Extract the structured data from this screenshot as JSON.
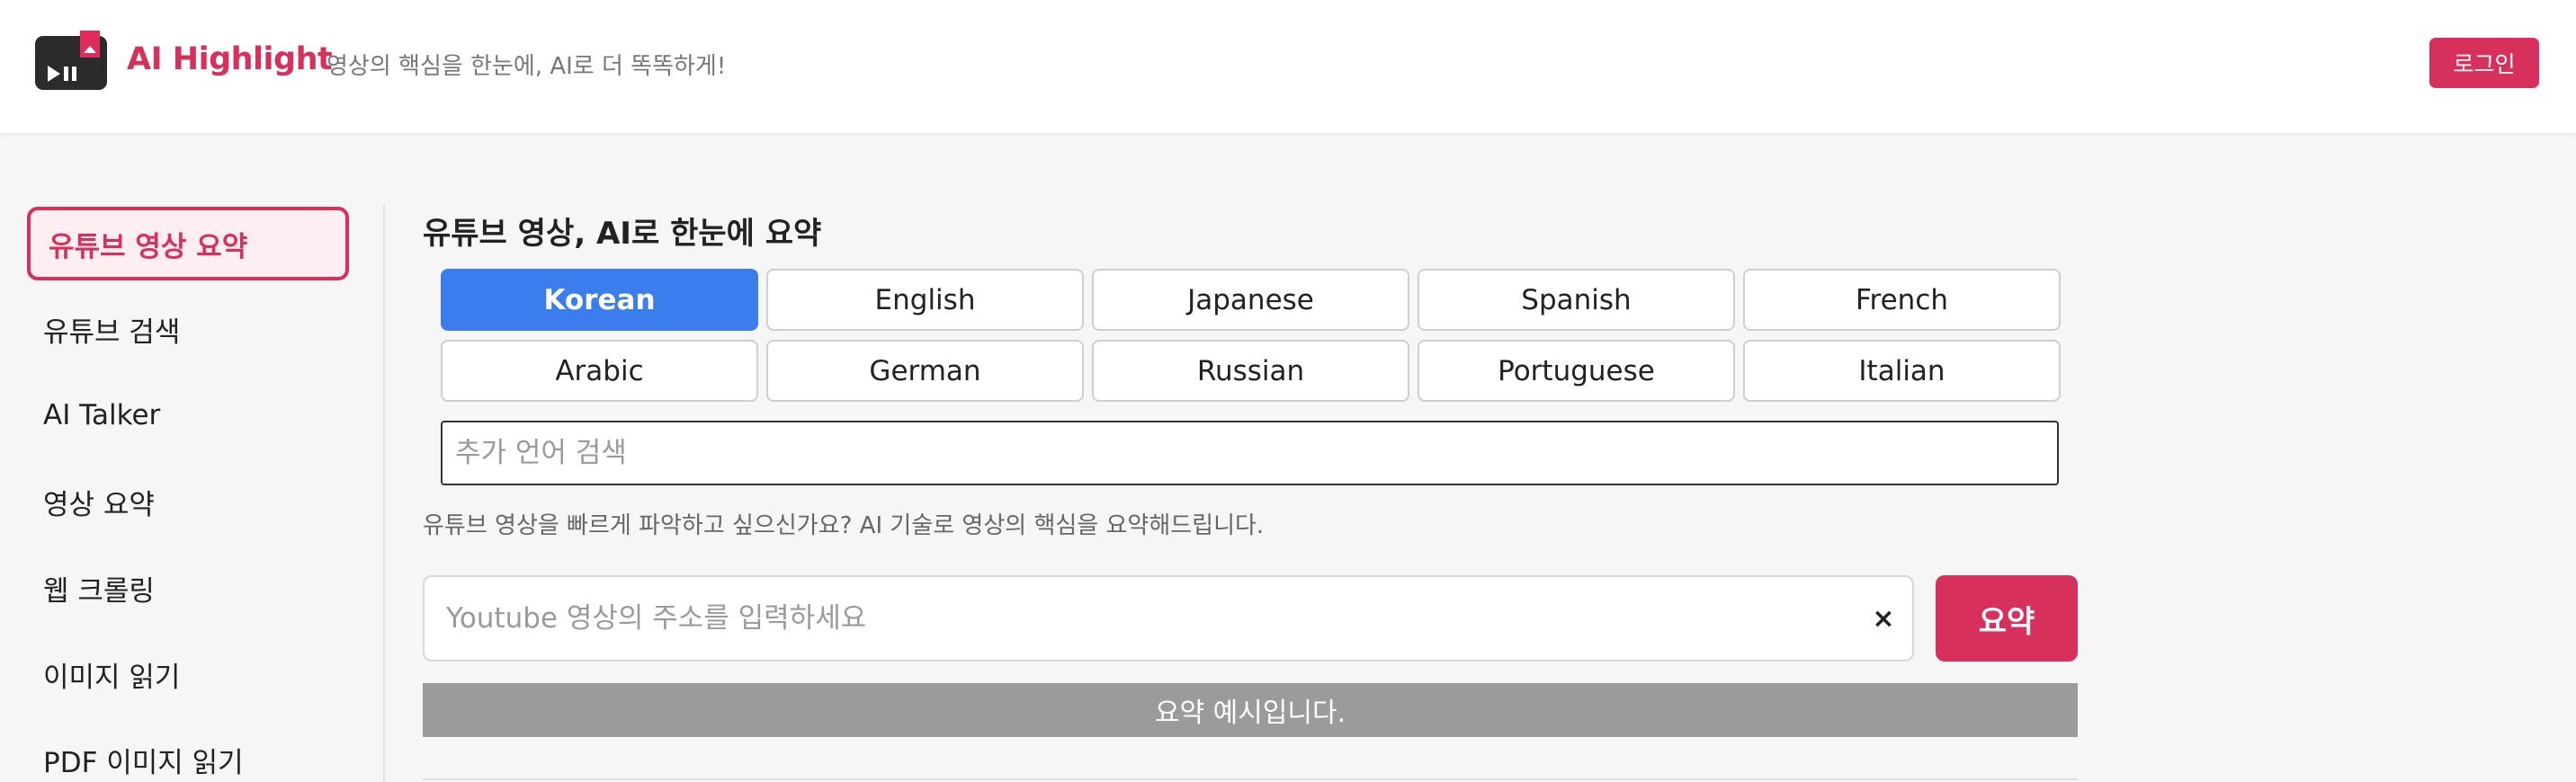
{
  "header": {
    "brand": "AI Highlight",
    "tagline": "영상의 핵심을 한눈에, AI로 더 똑똑하게!",
    "login_label": "로그인",
    "logo_icon": "play-pause-bookmark-icon",
    "accent_color": "#d8305c"
  },
  "sidebar": {
    "items": [
      {
        "label": "유튜브 영상 요약",
        "active": true
      },
      {
        "label": "유튜브 검색",
        "active": false
      },
      {
        "label": "AI Talker",
        "active": false
      },
      {
        "label": "영상 요약",
        "active": false
      },
      {
        "label": "웹 크롤링",
        "active": false
      },
      {
        "label": "이미지 읽기",
        "active": false
      },
      {
        "label": "PDF 이미지 읽기",
        "active": false
      }
    ]
  },
  "main": {
    "title": "유튜브 영상, AI로 한눈에 요약",
    "languages": [
      "Korean",
      "English",
      "Japanese",
      "Spanish",
      "French",
      "Arabic",
      "German",
      "Russian",
      "Portuguese",
      "Italian"
    ],
    "selected_language": "Korean",
    "selected_color": "#3b7ded",
    "language_search_placeholder": "추가 언어 검색",
    "language_search_value": "",
    "description": "유튜브 영상을 빠르게 파악하고 싶으신가요? AI 기술로 영상의 핵심을 요약해드립니다.",
    "url_placeholder": "Youtube 영상의 주소를 입력하세요",
    "url_value": "",
    "clear_symbol": "×",
    "summarize_label": "요약",
    "example_label": "요약 예시입니다."
  }
}
